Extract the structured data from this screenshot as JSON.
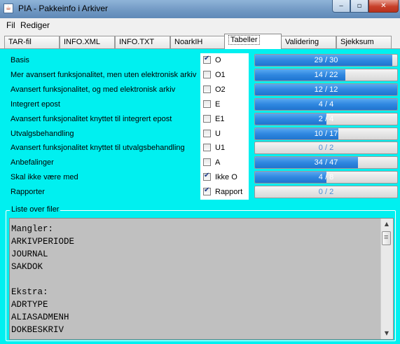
{
  "window": {
    "title": "PIA - Pakkeinfo i Arkiver",
    "icon": "java-cup-icon"
  },
  "menu": [
    "Fil",
    "Rediger"
  ],
  "tabs": [
    "TAR-fil",
    "INFO.XML",
    "INFO.TXT",
    "NoarkIH",
    "Tabeller",
    "Validering",
    "Sjekksum"
  ],
  "active_tab": "Tabeller",
  "rows": [
    {
      "label": "Basis",
      "code": "O",
      "checked": true,
      "current": 29,
      "total": 30,
      "text": "29 / 30"
    },
    {
      "label": "Mer avansert funksjonalitet, men uten elektronisk arkiv",
      "code": "O1",
      "checked": false,
      "current": 14,
      "total": 22,
      "text": "14 / 22"
    },
    {
      "label": "Avansert funksjonalitet, og med elektronisk arkiv",
      "code": "O2",
      "checked": false,
      "current": 12,
      "total": 12,
      "text": "12 / 12"
    },
    {
      "label": "Integrert epost",
      "code": "E",
      "checked": false,
      "current": 4,
      "total": 4,
      "text": "4 / 4"
    },
    {
      "label": "Avansert funksjonalitet knyttet til integrert epost",
      "code": "E1",
      "checked": false,
      "current": 2,
      "total": 4,
      "text": "2 / 4"
    },
    {
      "label": "Utvalgsbehandling",
      "code": "U",
      "checked": false,
      "current": 10,
      "total": 17,
      "text": "10 / 17"
    },
    {
      "label": "Avansert funksjonalitet knyttet til utvalgsbehandling",
      "code": "U1",
      "checked": false,
      "current": 0,
      "total": 2,
      "text": "0 / 2"
    },
    {
      "label": "Anbefalinger",
      "code": "A",
      "checked": false,
      "current": 34,
      "total": 47,
      "text": "34 / 47"
    },
    {
      "label": "Skal ikke være med",
      "code": "Ikke O",
      "checked": true,
      "current": 4,
      "total": 8,
      "text": "4 / 8"
    },
    {
      "label": "Rapporter",
      "code": "Rapport",
      "checked": true,
      "current": 0,
      "total": 2,
      "text": "0 / 2"
    }
  ],
  "file_list": {
    "title": "Liste over filer",
    "text": "Mangler:\nARKIVPERIODE\nJOURNAL\nSAKDOK\n\nEkstra:\nADRTYPE\nALIASADMENH\nDOKBESKRIV"
  }
}
